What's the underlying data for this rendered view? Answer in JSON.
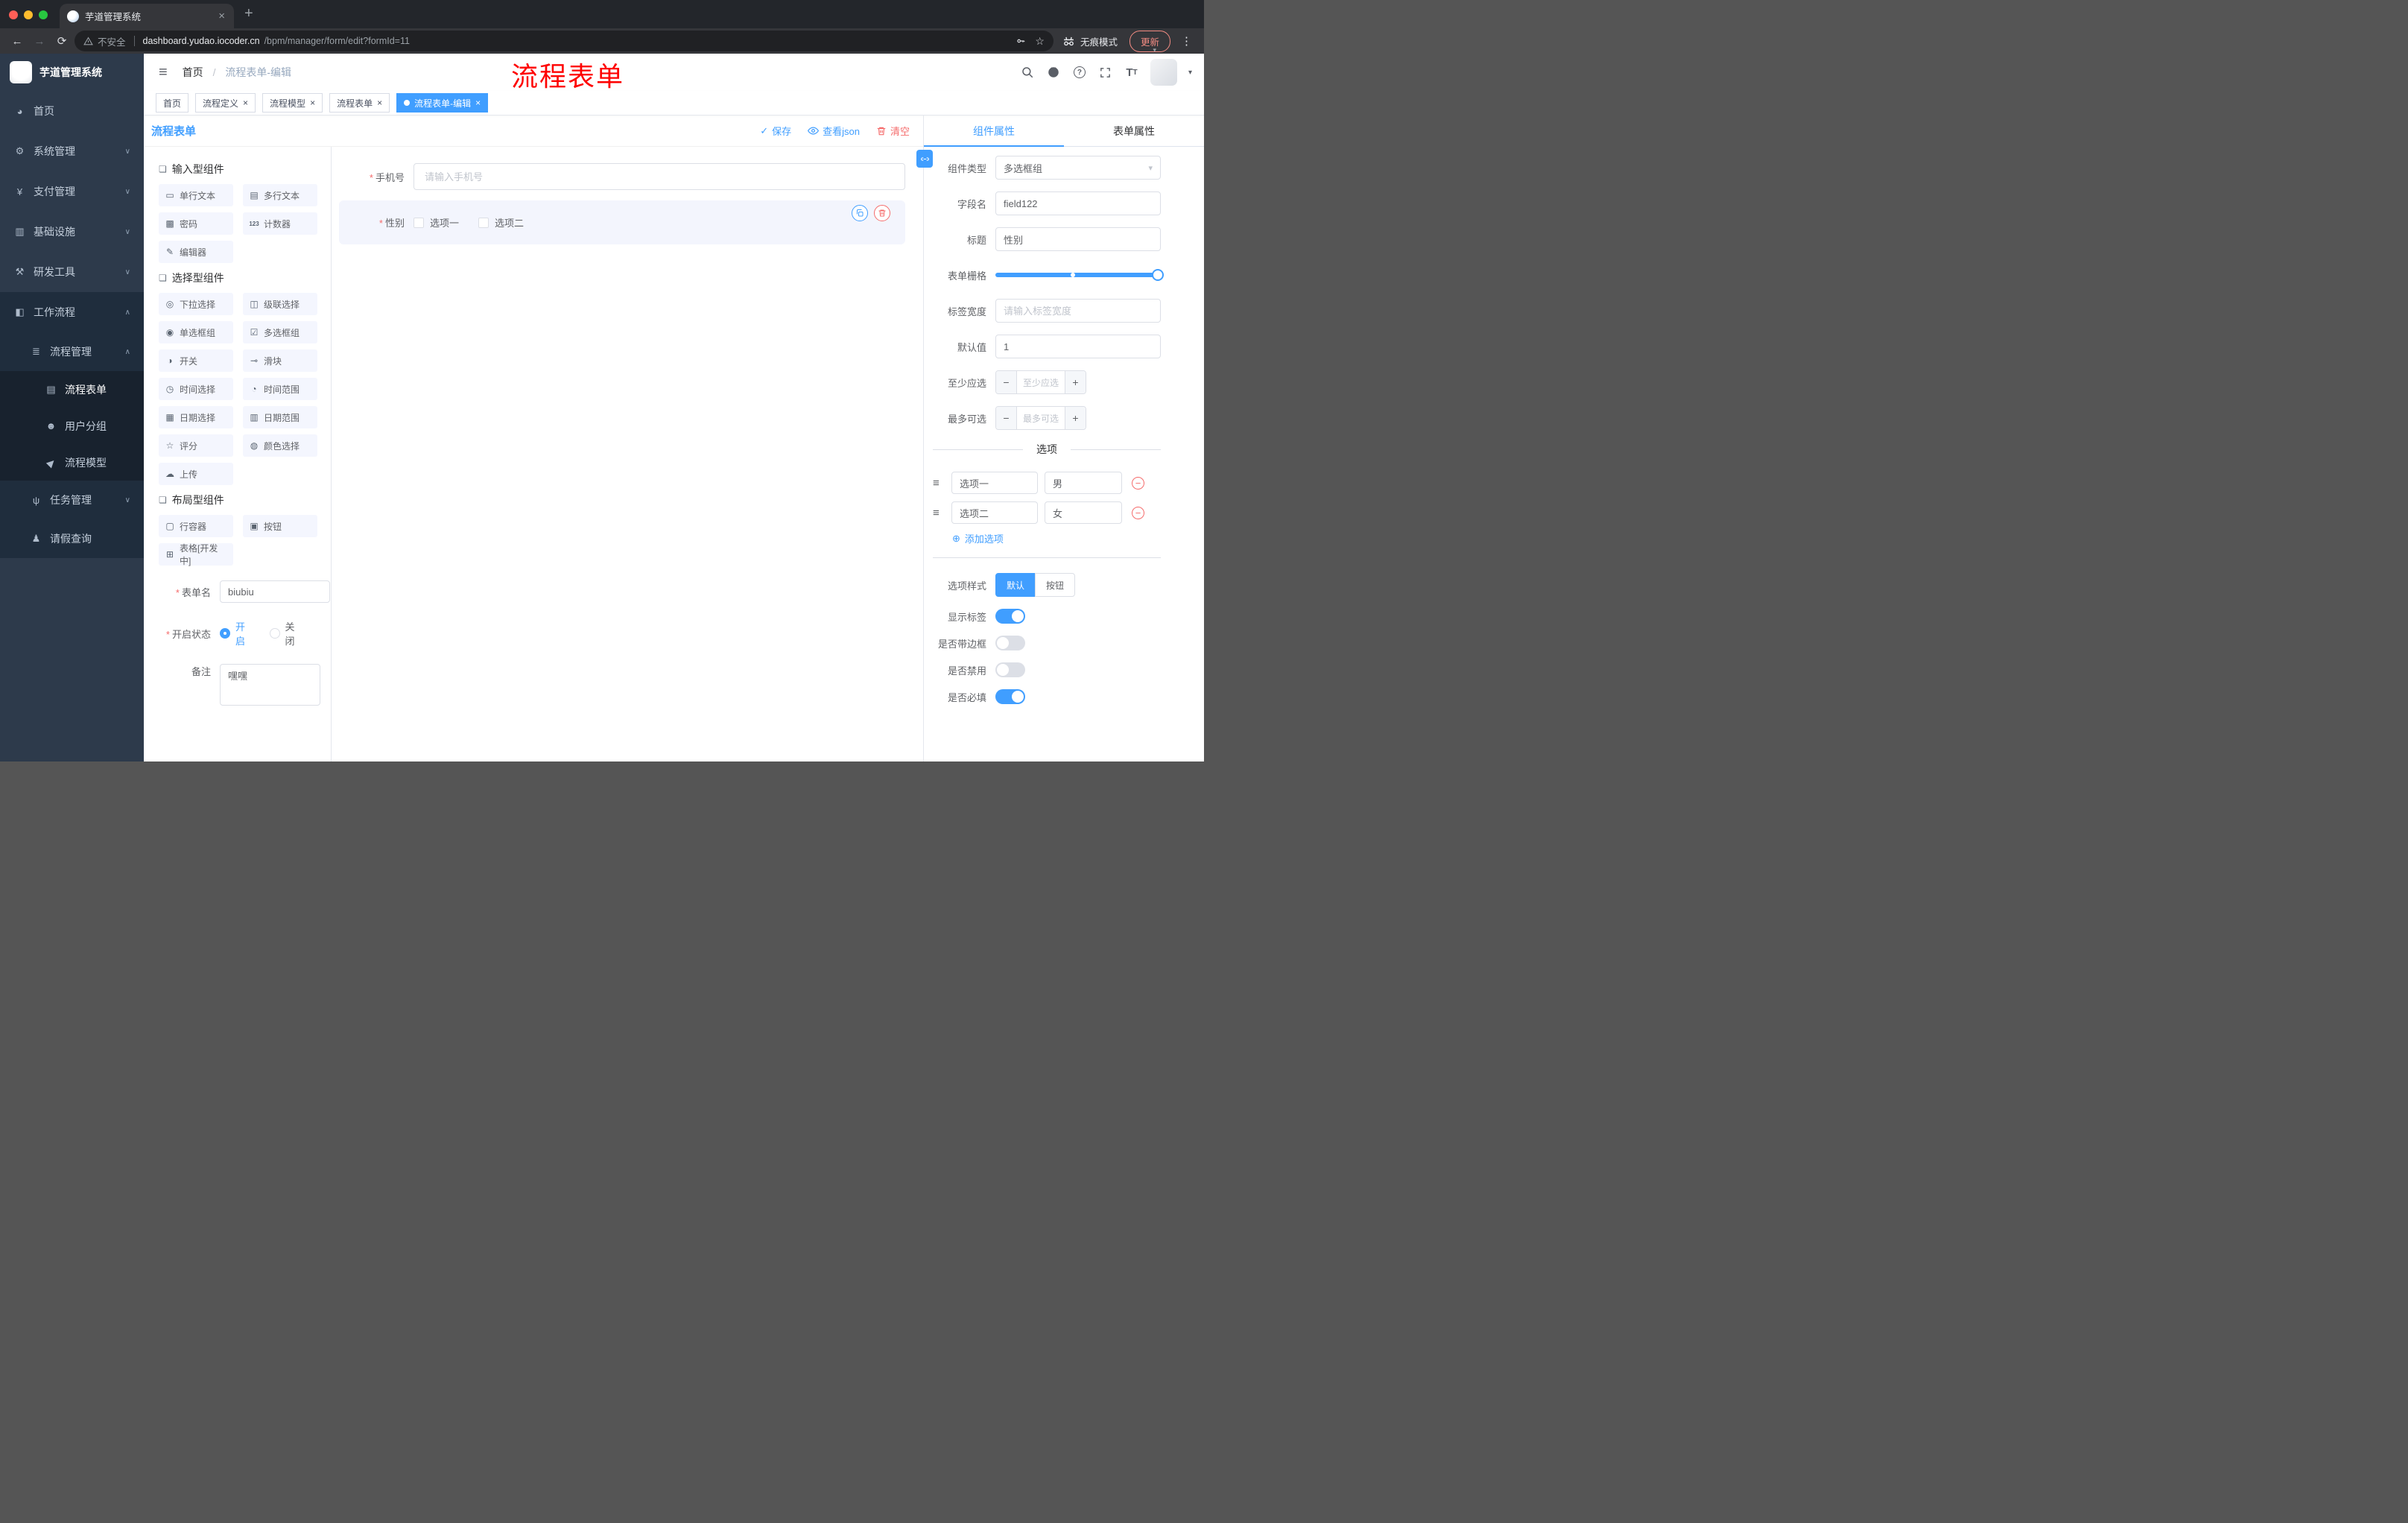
{
  "browser": {
    "tab_title": "芋道管理系统",
    "security_label": "不安全",
    "url_host": "dashboard.yudao.iocoder.cn",
    "url_path": "/bpm/manager/form/edit?formId=11",
    "incognito_label": "无痕模式",
    "update_label": "更新"
  },
  "annotation": "流程表单",
  "sidebar": {
    "logo_title": "芋道管理系统",
    "items": [
      {
        "label": "首页",
        "icon": "dashboard-icon"
      },
      {
        "label": "系统管理",
        "icon": "gear-icon",
        "chevron": "down"
      },
      {
        "label": "支付管理",
        "icon": "yen-icon",
        "chevron": "down"
      },
      {
        "label": "基础设施",
        "icon": "monitor-icon",
        "chevron": "down"
      },
      {
        "label": "研发工具",
        "icon": "tools-icon",
        "chevron": "down"
      },
      {
        "label": "工作流程",
        "icon": "workflow-icon",
        "chevron": "up"
      },
      {
        "label": "流程管理",
        "icon": "process-icon",
        "chevron": "up"
      },
      {
        "label": "流程表单",
        "icon": "form-icon",
        "active": true
      },
      {
        "label": "用户分组",
        "icon": "users-icon"
      },
      {
        "label": "流程模型",
        "icon": "send-icon"
      },
      {
        "label": "任务管理",
        "icon": "tree-icon",
        "chevron": "down"
      },
      {
        "label": "请假查询",
        "icon": "person-icon"
      }
    ]
  },
  "header": {
    "breadcrumb": [
      "首页",
      "流程表单-编辑"
    ],
    "icons": [
      "search-icon",
      "github-icon",
      "help-icon",
      "fullscreen-icon",
      "font-size-icon"
    ]
  },
  "tags": [
    {
      "label": "首页"
    },
    {
      "label": "流程定义",
      "closable": true
    },
    {
      "label": "流程模型",
      "closable": true
    },
    {
      "label": "流程表单",
      "closable": true
    },
    {
      "label": "流程表单-编辑",
      "closable": true,
      "active": true
    }
  ],
  "work": {
    "title": "流程表单",
    "actions": [
      {
        "label": "保存",
        "icon": "check-icon"
      },
      {
        "label": "查看json",
        "icon": "eye-icon"
      },
      {
        "label": "清空",
        "icon": "trash-icon"
      }
    ]
  },
  "palette": {
    "groups": [
      {
        "title": "输入型组件",
        "icon": "cube-icon",
        "items": [
          {
            "label": "单行文本",
            "icon": "single-line-text-icon"
          },
          {
            "label": "多行文本",
            "icon": "multi-line-text-icon"
          },
          {
            "label": "密码",
            "icon": "lock-icon"
          },
          {
            "label": "计数器",
            "icon": "counter-icon"
          },
          {
            "label": "编辑器",
            "icon": "editor-icon"
          }
        ]
      },
      {
        "title": "选择型组件",
        "icon": "cube-icon",
        "items": [
          {
            "label": "下拉选择",
            "icon": "select-icon"
          },
          {
            "label": "级联选择",
            "icon": "cascader-icon"
          },
          {
            "label": "单选框组",
            "icon": "radio-group-icon"
          },
          {
            "label": "多选框组",
            "icon": "checkbox-group-icon"
          },
          {
            "label": "开关",
            "icon": "switch-icon"
          },
          {
            "label": "滑块",
            "icon": "slider-icon"
          },
          {
            "label": "时间选择",
            "icon": "time-icon"
          },
          {
            "label": "时间范围",
            "icon": "time-range-icon"
          },
          {
            "label": "日期选择",
            "icon": "date-icon"
          },
          {
            "label": "日期范围",
            "icon": "date-range-icon"
          },
          {
            "label": "评分",
            "icon": "rate-icon"
          },
          {
            "label": "颜色选择",
            "icon": "color-icon"
          },
          {
            "label": "上传",
            "icon": "upload-icon"
          }
        ]
      },
      {
        "title": "布局型组件",
        "icon": "cube-icon",
        "items": [
          {
            "label": "行容器",
            "icon": "row-container-icon"
          },
          {
            "label": "按钮",
            "icon": "button-icon"
          },
          {
            "label": "表格[开发中]",
            "icon": "table-icon"
          }
        ]
      }
    ],
    "form": {
      "name_label": "表单名",
      "name_value": "biubiu",
      "status_label": "开启状态",
      "status_on": "开启",
      "status_off": "关闭",
      "status_value": "开启",
      "remark_label": "备注",
      "remark_value": "嘿嘿"
    }
  },
  "canvas": {
    "phone": {
      "label": "手机号",
      "placeholder": "请输入手机号",
      "required": true
    },
    "gender": {
      "label": "性别",
      "required": true,
      "selected": true,
      "options": [
        "选项一",
        "选项二"
      ]
    }
  },
  "props": {
    "tabs": {
      "component": "组件属性",
      "form": "表单属性"
    },
    "component_type": {
      "label": "组件类型",
      "value": "多选框组"
    },
    "field_name": {
      "label": "字段名",
      "value": "field122"
    },
    "title": {
      "label": "标题",
      "value": "性别"
    },
    "grid": {
      "label": "表单栅格"
    },
    "label_width": {
      "label": "标签宽度",
      "placeholder": "请输入标签宽度"
    },
    "default_value": {
      "label": "默认值",
      "value": "1"
    },
    "min_select": {
      "label": "至少应选",
      "placeholder": "至少应选"
    },
    "max_select": {
      "label": "最多可选",
      "placeholder": "最多可选"
    },
    "stepper_minus": "−",
    "stepper_plus": "+",
    "options_divider": "选项",
    "options": [
      {
        "label": "选项一",
        "value": "男"
      },
      {
        "label": "选项二",
        "value": "女"
      }
    ],
    "add_option": "添加选项",
    "option_style": {
      "label": "选项样式",
      "default": "默认",
      "button": "按钮"
    },
    "switches": [
      {
        "label": "显示标签",
        "on": true
      },
      {
        "label": "是否带边框",
        "on": false
      },
      {
        "label": "是否禁用",
        "on": false
      },
      {
        "label": "是否必填",
        "on": true
      }
    ]
  },
  "colors": {
    "accent": "#409eff",
    "danger": "#f56c6c",
    "annotation": "#fe0100",
    "sidebar_bg": "#2d3a4b"
  }
}
